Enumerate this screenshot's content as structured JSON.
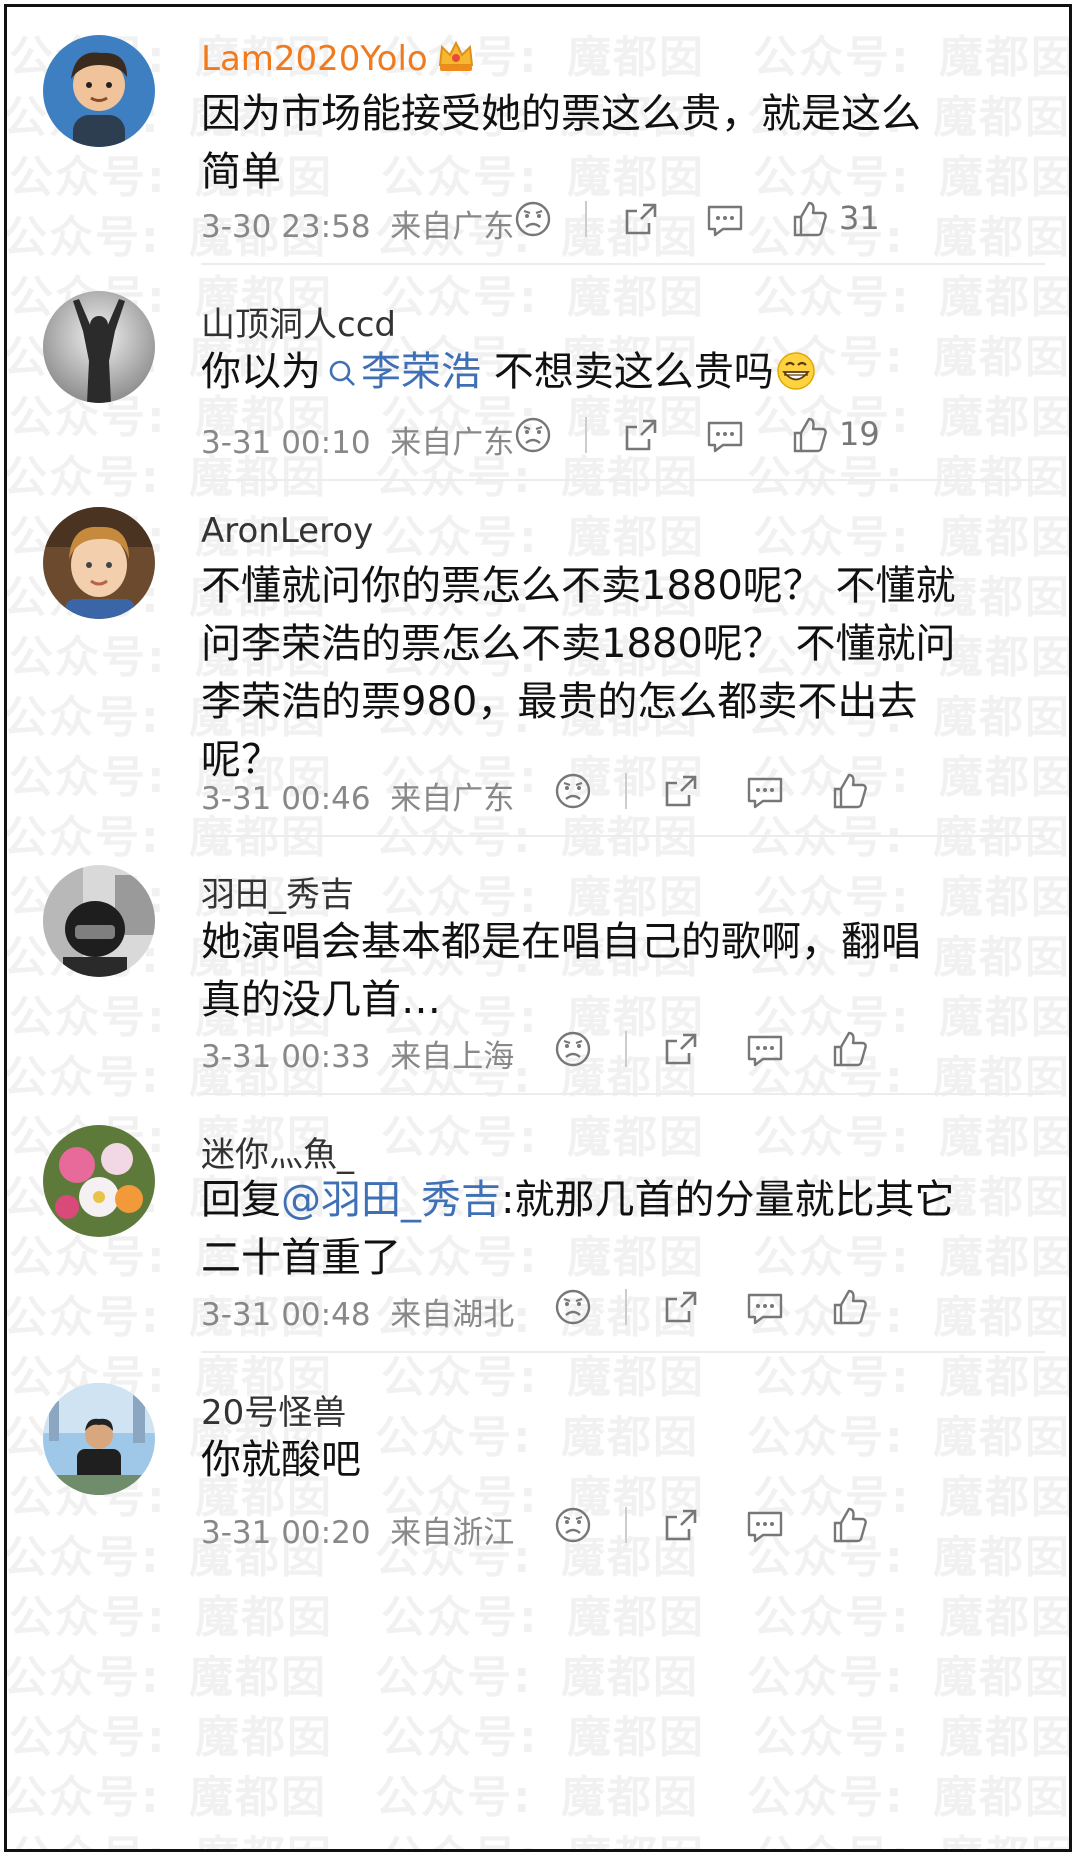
{
  "watermark": {
    "texts": [
      "公众号:",
      "魔都囡",
      "公众号:",
      "魔都囡",
      "公众号:",
      "魔都囡"
    ]
  },
  "comments": [
    {
      "username": "Lam2020Yolo",
      "vip": true,
      "text_line1": "因为市场能接受她的票这么贵，就是这么",
      "text_line2": "简单",
      "time": "3-30 23:58",
      "location": "来自广东",
      "likes": "31",
      "avatar": "cartoon-man-avatar"
    },
    {
      "username": "山顶洞人ccd",
      "vip": false,
      "text_pre": "你以为",
      "text_link": "李荣浩",
      "text_post": " 不想卖这么贵吗",
      "emoji": "grin-emoji",
      "time": "3-31 00:10",
      "location": "来自广东",
      "likes": "19",
      "avatar": "silhouette-avatar"
    },
    {
      "username": "AronLeroy",
      "vip": false,
      "text_line1": "不懂就问你的票怎么不卖1880呢？ 不懂就",
      "text_line2": "问李荣浩的票怎么不卖1880呢？ 不懂就问",
      "text_line3": "李荣浩的票980，最贵的怎么都卖不出去",
      "text_line4": "呢？",
      "time": "3-31 00:46",
      "location": "来自广东",
      "likes": "",
      "avatar": "boy-photo-avatar"
    },
    {
      "username": "羽田_秀吉",
      "vip": false,
      "text_line1": "她演唱会基本都是在唱自己的歌啊，翻唱",
      "text_line2": "真的没几首…",
      "time": "3-31 00:33",
      "location": "来自上海",
      "likes": "",
      "avatar": "helmet-photo-avatar"
    },
    {
      "username": "迷你灬魚_",
      "vip": false,
      "reply_prefix": "回复",
      "reply_link": "@羽田_秀吉",
      "text_line1_rest": ":就那几首的分量就比其它",
      "text_line2": "二十首重了",
      "time": "3-31 00:48",
      "location": "来自湖北",
      "likes": "",
      "avatar": "flowers-avatar"
    },
    {
      "username": "20号怪兽",
      "vip": false,
      "text_line1": "你就酸吧",
      "time": "3-31 00:20",
      "location": "来自浙江",
      "likes": "",
      "avatar": "city-man-avatar"
    }
  ],
  "icons": {
    "dislike": "sad-face-icon",
    "share": "share-icon",
    "comment": "comment-bubble-icon",
    "like": "thumbs-up-icon"
  },
  "colors": {
    "vip_name": "#f07a1e",
    "link": "#3f6fb5",
    "meta": "#888888",
    "text": "#111111"
  }
}
